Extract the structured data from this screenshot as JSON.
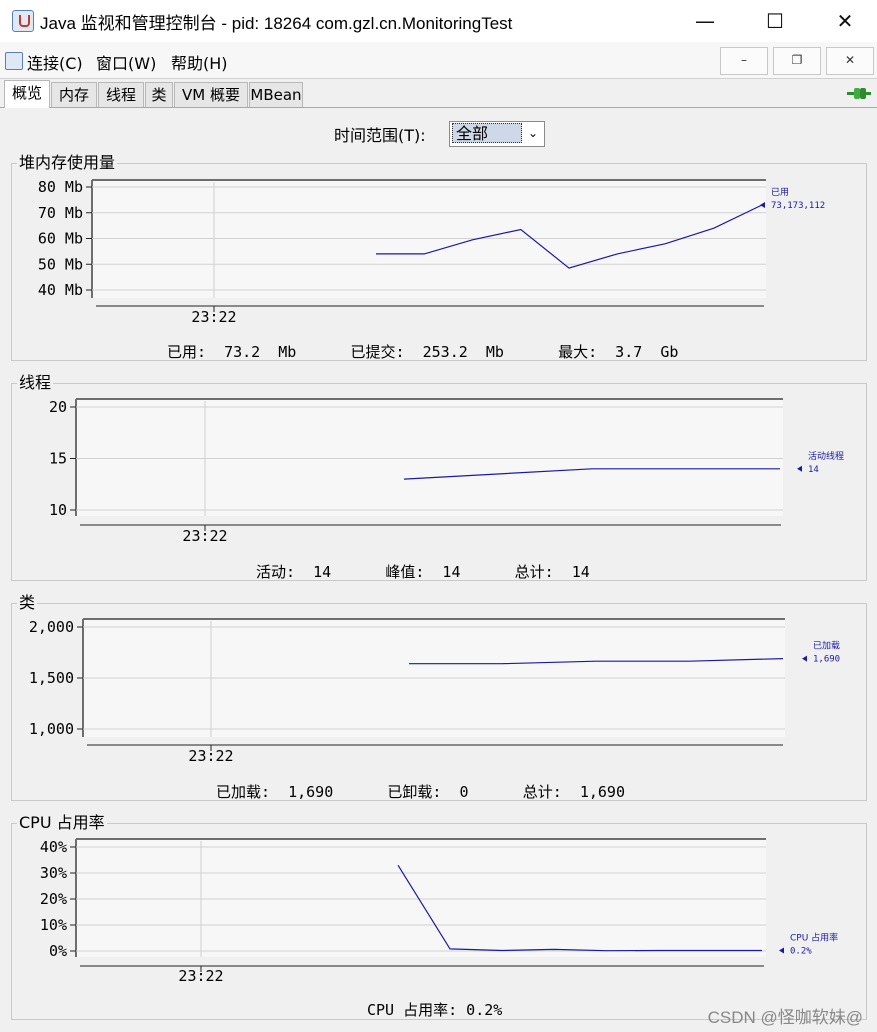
{
  "window": {
    "title": "Java 监视和管理控制台 - pid: 18264 com.gzl.cn.MonitoringTest"
  },
  "menu": [
    "连接(C)",
    "窗口(W)",
    "帮助(H)"
  ],
  "tabs": [
    "概览",
    "内存",
    "线程",
    "类",
    "VM 概要",
    "MBean"
  ],
  "active_tab": "概览",
  "time_range": {
    "label": "时间范围(T):",
    "value": "全部"
  },
  "panels": {
    "heap": {
      "title": "堆内存使用量",
      "stats": "已用:  73.2  Mb      已提交:  253.2  Mb      最大:  3.7  Gb"
    },
    "threads": {
      "title": "线程",
      "stats": "活动:  14      峰值:  14      总计:  14"
    },
    "classes": {
      "title": "类",
      "stats": "已加载:  1,690      已卸载:  0      总计:  1,690"
    },
    "cpu": {
      "title": "CPU 占用率",
      "stats": "CPU 占用率: 0.2%"
    }
  },
  "chart_data": [
    {
      "type": "line",
      "title": "堆内存使用量",
      "ylabel": "Mb",
      "ylim": [
        40,
        80
      ],
      "yticks": [
        "80 Mb",
        "70 Mb",
        "60 Mb",
        "50 Mb",
        "40 Mb"
      ],
      "xtick": "23:22",
      "series": [
        {
          "name": "已用",
          "value_label": "73,173,112",
          "color": "#1a1aa6",
          "x": [
            0,
            1,
            2,
            3,
            4,
            5,
            6,
            7,
            8
          ],
          "values": [
            54,
            54,
            59.5,
            63.5,
            48.5,
            54,
            58,
            64,
            73
          ]
        }
      ]
    },
    {
      "type": "line",
      "title": "线程",
      "ylim": [
        10,
        20
      ],
      "yticks": [
        "20",
        "15",
        "10"
      ],
      "xtick": "23:22",
      "series": [
        {
          "name": "活动线程",
          "value_label": "14",
          "color": "#1a1aa6",
          "x": [
            0,
            1,
            2
          ],
          "values": [
            13,
            14,
            14
          ]
        }
      ]
    },
    {
      "type": "line",
      "title": "类",
      "ylim": [
        1000,
        2000
      ],
      "yticks": [
        "2,000",
        "1,500",
        "1,000"
      ],
      "xtick": "23:22",
      "series": [
        {
          "name": "已加载",
          "value_label": "1,690",
          "color": "#1a1aa6",
          "x": [
            0,
            1,
            2,
            3,
            4
          ],
          "values": [
            1640,
            1640,
            1665,
            1665,
            1690
          ]
        }
      ]
    },
    {
      "type": "line",
      "title": "CPU 占用率",
      "ylim": [
        0,
        40
      ],
      "yticks": [
        "40%",
        "30%",
        "20%",
        "10%",
        "0%"
      ],
      "xtick": "23:22",
      "series": [
        {
          "name": "CPU 占用率",
          "value_label": "0.2%",
          "color": "#1a1aa6",
          "x": [
            0,
            1,
            2,
            3,
            4,
            5,
            6,
            7
          ],
          "values": [
            33,
            0.8,
            0.2,
            0.6,
            0.1,
            0.2,
            0.2,
            0.2
          ]
        }
      ]
    }
  ],
  "watermark": "CSDN @怪咖软妹@"
}
